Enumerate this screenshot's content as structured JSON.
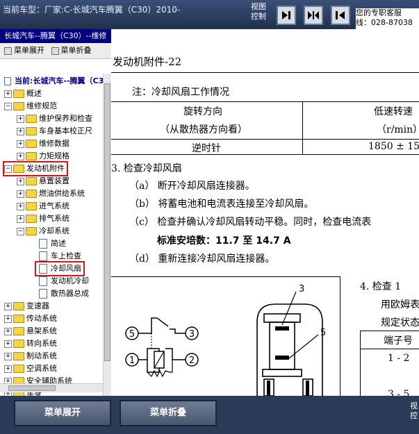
{
  "header": {
    "vehicle_label": "当前车型：厂家:C-长城汽车腾翼（C30）2010-",
    "view_control_line1": "视图",
    "view_control_line2": "控制",
    "service_line1": "您的专职客服",
    "service_line2": "线：028-87038"
  },
  "sidebar": {
    "title": "长城汽车--腾翼（C30）--维修",
    "expand_label": "菜单展开",
    "collapse_label": "菜单折叠",
    "current": "当前:长城汽车--腾翼（C30",
    "tree": [
      "概述",
      "维修规范",
      "维护保养和检查",
      "车身基本校正尺",
      "维修数据",
      "力矩规格",
      "发动机附件",
      "悬置装置",
      "燃油供给系统",
      "进气系统",
      "排气系统",
      "冷却系统",
      "简述",
      "车上检查",
      "冷却风扇",
      "发动机冷却",
      "散热器总成",
      "变速器",
      "传动系统",
      "悬架系统",
      "转向系统",
      "制动系统",
      "空调系统",
      "安全辅助系统",
      "车身"
    ]
  },
  "doc": {
    "title": "发动机附件-22",
    "note": "注：冷却风扇工作情况",
    "table_header_col1_line1": "旋转方向",
    "table_header_col1_line2": "（从散热器方向看）",
    "table_header_col2_line1": "低速转速",
    "table_header_col2_line2": "（r/min）",
    "table_row1_col1": "逆时针",
    "table_row1_col2": "1850 ± 15",
    "step3_title": "3.  检查冷却风扇",
    "step_a": "（a）   断开冷却风扇连接器。",
    "step_b": "（b）   将蓄电池和电流表连接至冷却风扇。",
    "step_c": "（c）   检查并确认冷却风扇转动平稳。同时，检查电流表",
    "std_current": "标准安培数：11.7 至 14.7 A",
    "step_d": "（d）   重新连接冷却风扇连接器。",
    "step4_title": "4.  检查 1",
    "step4_line2": "用欧姆表",
    "step4_line3": "规定状态",
    "terminal_header": "端子号",
    "terminal_row1": "1 - 2",
    "terminal_row2": "3 - 5",
    "pin_labels": [
      "1",
      "2",
      "3",
      "5"
    ],
    "callout_3": "3",
    "callout_5": "5"
  },
  "footer": {
    "expand_label": "菜单展开",
    "collapse_label": "菜单折叠",
    "view_control_line1": "视",
    "view_control_line2": "控"
  }
}
